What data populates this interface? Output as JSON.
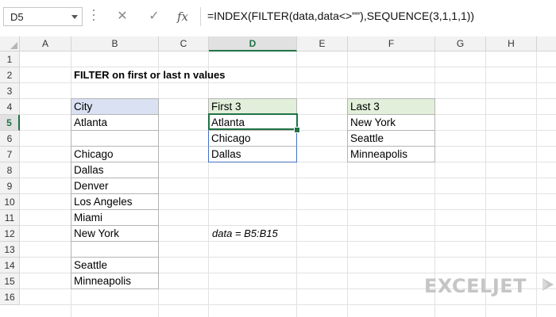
{
  "formula_bar": {
    "name_box": "D5",
    "cancel_glyph": "✕",
    "enter_glyph": "✓",
    "fx_label": "fx",
    "formula": "=INDEX(FILTER(data,data<>\"\"),SEQUENCE(3,1,1,1))"
  },
  "columns": [
    "A",
    "B",
    "C",
    "D",
    "E",
    "F",
    "G",
    "H"
  ],
  "rows": [
    "1",
    "2",
    "3",
    "4",
    "5",
    "6",
    "7",
    "8",
    "9",
    "10",
    "11",
    "12",
    "13",
    "14",
    "15",
    "16"
  ],
  "active_cell": {
    "column": "D",
    "row": "5"
  },
  "sheet": {
    "title": "FILTER on first or last n values",
    "city_header": "City",
    "cities": [
      "Atlanta",
      "",
      "Chicago",
      "Dallas",
      "Denver",
      "Los Angeles",
      "Miami",
      "New York",
      "",
      "Seattle",
      "Minneapolis"
    ],
    "first3_header": "First 3",
    "first3": [
      "Atlanta",
      "Chicago",
      "Dallas"
    ],
    "last3_header": "Last 3",
    "last3": [
      "New York",
      "Seattle",
      "Minneapolis"
    ],
    "note": "data = B5:B15"
  },
  "branding": {
    "logo_text": "EXCELJET"
  },
  "colors": {
    "accent_green": "#217346",
    "header_blue": "#d9e1f2",
    "header_green": "#e2efda",
    "range_blue": "#4472c4"
  }
}
